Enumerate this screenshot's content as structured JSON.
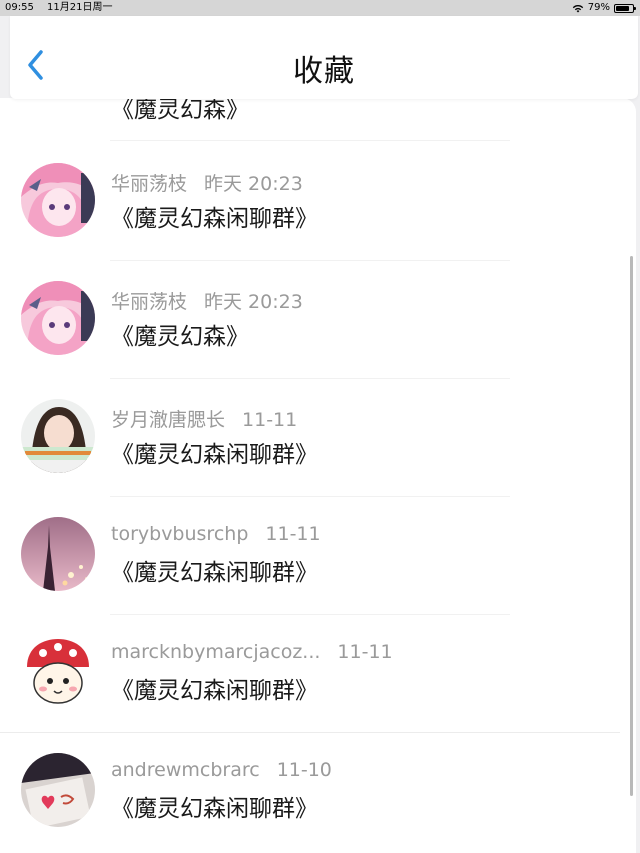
{
  "status_bar": {
    "time": "09:55",
    "date": "11月21日周一",
    "battery": "79%",
    "battery_level": 0.79
  },
  "nav": {
    "title": "收藏",
    "accent": "#2f8fe0"
  },
  "list": {
    "partial_item_text": "《魔灵幻森》",
    "items": [
      {
        "sender": "华丽荡枝",
        "time": "昨天 20:23",
        "content": "《魔灵幻森闲聊群》",
        "avatar": "anime-pink-hair"
      },
      {
        "sender": "华丽荡枝",
        "time": "昨天 20:23",
        "content": "《魔灵幻森》",
        "avatar": "anime-pink-hair"
      },
      {
        "sender": "岁月澈唐腮长",
        "time": "11-11",
        "content": "《魔灵幻森闲聊群》",
        "avatar": "girl-photo"
      },
      {
        "sender": "torybvbusrchp",
        "time": "11-11",
        "content": "《魔灵幻森闲聊群》",
        "avatar": "eiffel-tower"
      },
      {
        "sender": "marcknbymarcjacoz...",
        "time": "11-11",
        "content": "《魔灵幻森闲聊群》",
        "avatar": "cartoon-hamster"
      },
      {
        "sender": "andrewmcbrarc",
        "time": "11-10",
        "content": "《魔灵幻森闲聊群》",
        "avatar": "i-love-you-sketch"
      }
    ]
  }
}
